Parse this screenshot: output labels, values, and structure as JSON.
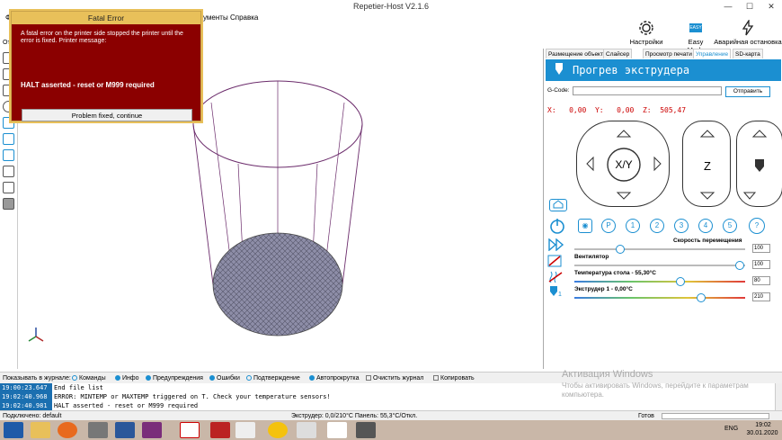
{
  "window": {
    "title": "Repetier-Host V2.1.6",
    "minimize": "—",
    "maximize": "☐",
    "close": "✕"
  },
  "menu": {
    "file_fragment": "Ф",
    "tools_fragment": "ументы",
    "help": "Справка",
    "other_fragment": "От"
  },
  "toolbar": {
    "printer_settings": "Настройки принтера",
    "easy_mode": "Easy Mode",
    "easy_badge": "EASY",
    "emergency_stop": "Аварийная остановка"
  },
  "tabs": [
    {
      "label": "Размещение объекта",
      "active": false
    },
    {
      "label": "Слайсер",
      "active": false
    },
    {
      "label": "Просмотр печати",
      "active": false
    },
    {
      "label": "Управление",
      "active": true
    },
    {
      "label": "SD-карта",
      "active": false
    }
  ],
  "control": {
    "header": "Прогрев экструдера",
    "gcode_label": "G-Code:",
    "gcode_value": "",
    "send_label": "Отправить",
    "coords": "X:   0,00  Y:   0,00  Z:  505,47",
    "xy_label": "X/Y",
    "z_label": "Z",
    "home_icon": "house-icon",
    "buttons": [
      "P",
      "1",
      "2",
      "3",
      "4",
      "5",
      "?"
    ]
  },
  "sliders": [
    {
      "label": "Скорость перемещения",
      "value": "100",
      "fraction": 0.27
    },
    {
      "label": "Вентилятор",
      "value": "100",
      "fraction": 0.97
    },
    {
      "label": "Температура стола - 55,30°C",
      "value": "80",
      "fraction": 0.62
    },
    {
      "label": "Экструдер 1 - 0,00°C",
      "value": "210",
      "fraction": 0.74
    }
  ],
  "extruder_number": "1",
  "dialog": {
    "title": "Fatal Error",
    "message": "A fatal error on the printer side stopped the printer until the error is fixed. Printer message:",
    "error": "HALT asserted - reset or M999 required",
    "button": "Problem fixed, continue"
  },
  "logbar": {
    "show_label": "Показывать в журнале:",
    "commands": "Команды",
    "info": "Инфо",
    "warnings": "Предупреждения",
    "errors": "Ошибки",
    "ack": "Подтверждение",
    "autoscroll": "Автопрокрутка",
    "clear": "Очистить журнал",
    "copy": "Копировать"
  },
  "log": [
    {
      "time": "19:00:23.647",
      "text": "End file list"
    },
    {
      "time": "19:02:40.968",
      "text": "ERROR: MINTEMP or MAXTEMP triggered on T. Check your temperature sensors!"
    },
    {
      "time": "19:02:40.981",
      "text": "HALT asserted - reset or M999 required"
    }
  ],
  "watermark": {
    "title": "Активация Windows",
    "text": "Чтобы активировать Windows, перейдите к параметрам компьютера."
  },
  "status": {
    "connection": "Подключено: default",
    "temps": "Экструдер: 0,0/210°C Панель: 55,3°C/Откл.",
    "ready": "Готов"
  },
  "taskbar": {
    "lang": "ENG",
    "time": "19:02",
    "date": "30.01.2020"
  },
  "colors": {
    "accent": "#1b8fd1",
    "dialog_bg": "#8b0000",
    "dialog_title": "#e8c05a"
  }
}
